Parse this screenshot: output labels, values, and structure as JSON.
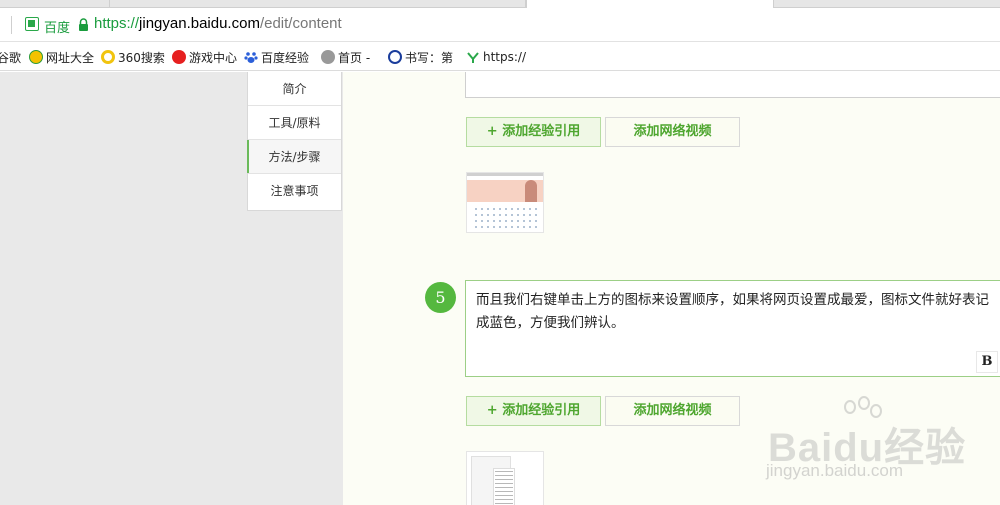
{
  "browser": {
    "site_name": "百度",
    "url": {
      "scheme": "https://",
      "host": "jingyan.baidu.com",
      "path": "/edit/content"
    },
    "bookmarks": [
      {
        "label": "谷歌",
        "icon": "none"
      },
      {
        "label": "网址大全",
        "icon": "hao123-icon"
      },
      {
        "label": "360搜索",
        "icon": "360-search-icon"
      },
      {
        "label": "游戏中心",
        "icon": "game-center-icon"
      },
      {
        "label": "百度经验",
        "icon": "baidu-paw-icon"
      },
      {
        "label": "首页 -",
        "icon": "home-icon"
      },
      {
        "label": "书写：第",
        "icon": "q-icon"
      },
      {
        "label": "https://",
        "icon": "https-icon"
      }
    ]
  },
  "section_nav": {
    "items": [
      {
        "label": "简介"
      },
      {
        "label": "工具/原料"
      },
      {
        "label": "方法/步骤",
        "active": true
      },
      {
        "label": "注意事项"
      }
    ]
  },
  "editor": {
    "step_number": "5",
    "step_text": "而且我们右键单击上方的图标来设置顺序，如果将网页设置成最爱，图标文件就好表记成蓝色，方便我们辨认。",
    "bold_label": "B",
    "cite_label": "+ 添加经验引用",
    "video_label": "添加网络视频",
    "accent_color": "#55b83f"
  },
  "watermark": {
    "brand": "Baidu经验",
    "domain": "jingyan.baidu.com"
  }
}
